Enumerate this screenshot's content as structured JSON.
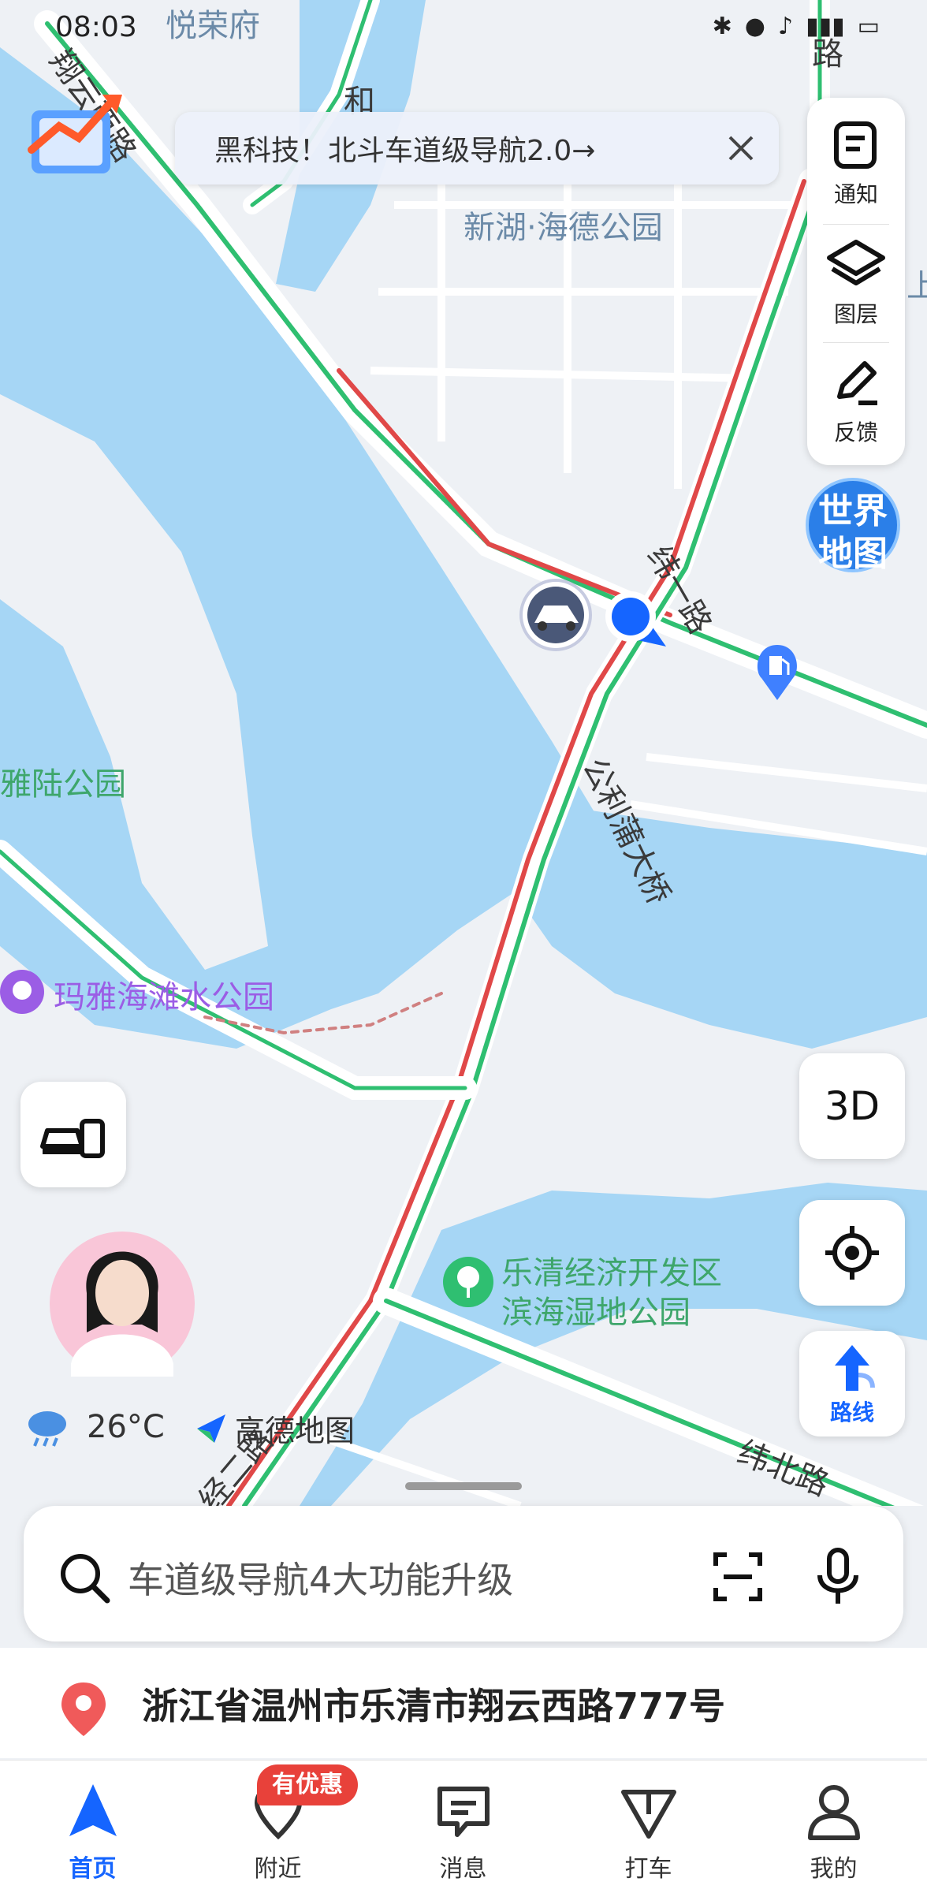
{
  "status_bar": {
    "time": "08:03"
  },
  "banner": {
    "text": "黑科技！北斗车道级导航2.0→"
  },
  "side_panel": {
    "notify_label": "通知",
    "layers_label": "图层",
    "feedback_label": "反馈"
  },
  "world_map_badge": {
    "line1": "世界",
    "line2": "地图"
  },
  "map_labels": {
    "top_place": "悦荣府",
    "park_haide": "新湖·海德公园",
    "road_wei1": "纬一路",
    "bridge": "公利蒲大桥",
    "yalu_park": "雅陆公园",
    "maya_park": "玛雅海滩水公园",
    "wetland_line1": "乐清经济开发区",
    "wetland_line2": "滨海湿地公园",
    "road_weibei": "纬北路",
    "road_jing2": "经二路",
    "road_xiangyun": "翔云西路",
    "road_he": "和",
    "road_top_right": "路",
    "road_top_right2": "上"
  },
  "map_buttons": {
    "three_d_label": "3D",
    "route_label": "路线"
  },
  "weather": {
    "temperature": "26°C"
  },
  "brand": {
    "name": "高德地图"
  },
  "search": {
    "placeholder": "车道级导航4大功能升级"
  },
  "location": {
    "address": "浙江省温州市乐清市翔云西路777号"
  },
  "tabs": [
    {
      "label": "首页",
      "active": true
    },
    {
      "label": "附近",
      "active": false
    },
    {
      "label": "消息",
      "active": false
    },
    {
      "label": "打车",
      "active": false
    },
    {
      "label": "我的",
      "active": false
    }
  ],
  "badge": {
    "text": "有优惠"
  },
  "colors": {
    "water": "#a6d6f5",
    "road_green": "#2fbf71",
    "road_red": "#e04848",
    "accent_blue": "#1565ff"
  }
}
